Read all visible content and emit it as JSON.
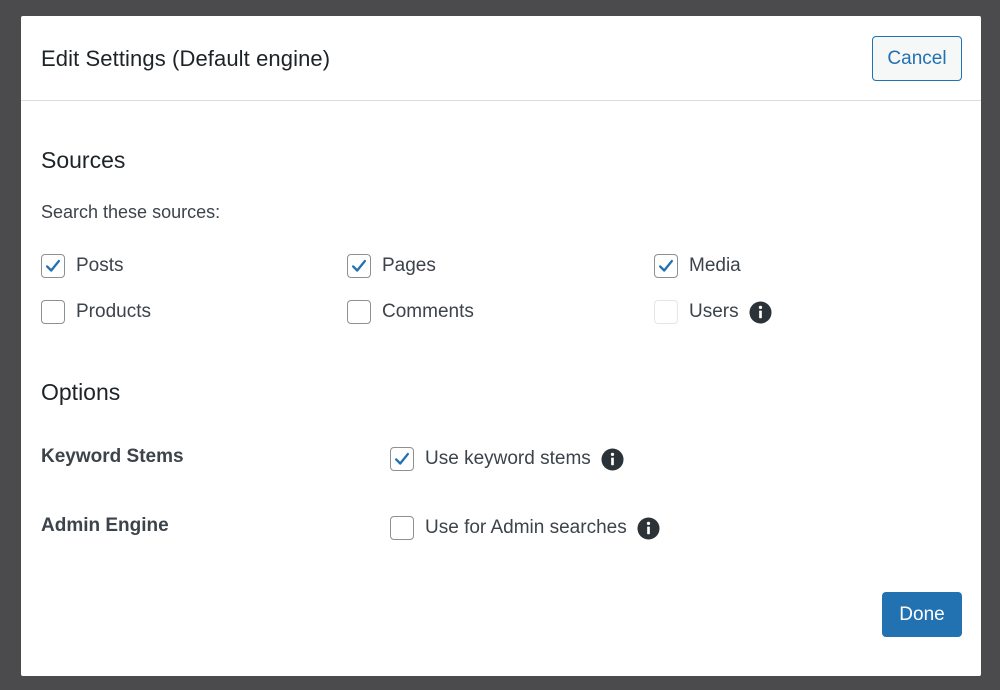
{
  "modal": {
    "title": "Edit Settings (Default engine)",
    "cancel_label": "Cancel",
    "done_label": "Done"
  },
  "sources": {
    "title": "Sources",
    "description": "Search these sources:",
    "items": [
      {
        "label": "Posts",
        "checked": true,
        "disabled": false
      },
      {
        "label": "Pages",
        "checked": true,
        "disabled": false
      },
      {
        "label": "Media",
        "checked": true,
        "disabled": false
      },
      {
        "label": "Products",
        "checked": false,
        "disabled": false
      },
      {
        "label": "Comments",
        "checked": false,
        "disabled": false
      },
      {
        "label": "Users",
        "checked": false,
        "disabled": true,
        "has_info_icon": true
      }
    ]
  },
  "options": {
    "title": "Options",
    "items": [
      {
        "name": "Keyword Stems",
        "checkbox_label": "Use keyword stems",
        "checked": true,
        "has_info_icon": true
      },
      {
        "name": "Admin Engine",
        "checkbox_label": "Use for Admin searches",
        "checked": false,
        "has_info_icon": true
      }
    ]
  },
  "colors": {
    "accent": "#2271b1",
    "checkmark": "#2271b1",
    "backdrop": "#4b4b4d"
  },
  "icons": {
    "check": "checkmark-icon",
    "info": "info-icon"
  }
}
